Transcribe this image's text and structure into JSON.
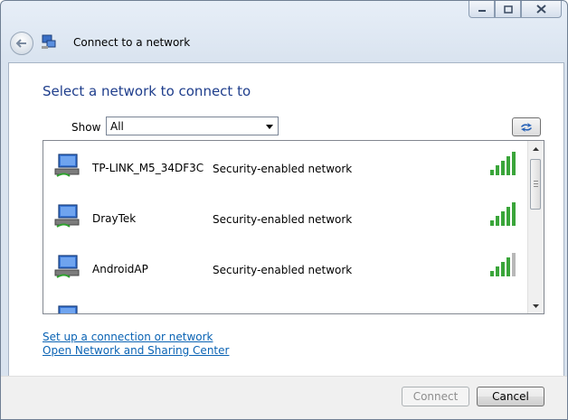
{
  "window": {
    "title": "Connect to a network",
    "caption_icons": [
      "minimize-icon",
      "maximize-icon",
      "close-icon"
    ]
  },
  "main": {
    "heading": "Select a network to connect to",
    "show_label": "Show",
    "show_value": "All",
    "networks": [
      {
        "name": "TP-LINK_M5_34DF3C",
        "security": "Security-enabled network",
        "signal_bars": 5
      },
      {
        "name": "DrayTek",
        "security": "Security-enabled network",
        "signal_bars": 5
      },
      {
        "name": "AndroidAP",
        "security": "Security-enabled network",
        "signal_bars": 4
      }
    ]
  },
  "links": {
    "setup": "Set up a connection or network",
    "sharing_center": "Open Network and Sharing Center"
  },
  "footer": {
    "connect_label": "Connect",
    "cancel_label": "Cancel"
  },
  "colors": {
    "heading": "#1f3e8c",
    "link": "#0a63b4",
    "signal_on": "#3aa53a",
    "signal_off": "#b8b8b8"
  }
}
